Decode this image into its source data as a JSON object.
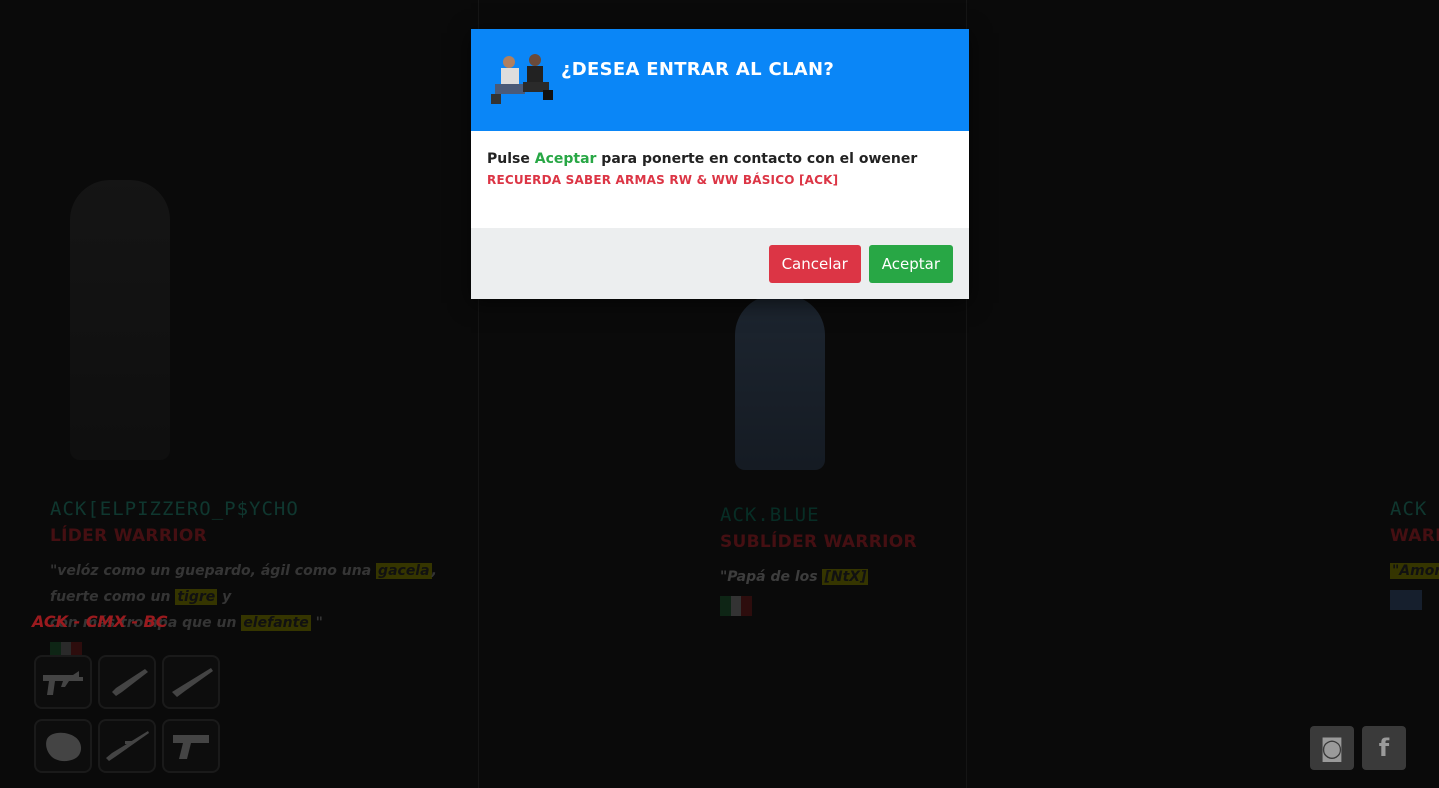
{
  "members": [
    {
      "nick": "ACK[ELPIZZERO_P$YCHO",
      "rank": "LÍDER WARRIOR",
      "quote_parts": [
        "\"velóz como un guepardo, ágil como una ",
        "gacela",
        ",",
        "fuerte como un ",
        "tigre",
        " y",
        "con más trompa que un ",
        "elefante",
        " \""
      ]
    },
    {
      "nick": "ACK.BLUE",
      "rank": "SUBLÍDER WARRIOR",
      "quote_parts": [
        "\"Papá de los ",
        "[NtX]"
      ]
    },
    {
      "nick": "ACK",
      "rank": "WARR",
      "quote_parts": [
        "\"Amor"
      ]
    }
  ],
  "clan_tag": "ACK - CMX - BC",
  "weapons": [
    "smg-icon",
    "shotgun-icon",
    "rifle-icon",
    "fist-icon",
    "sniper-icon",
    "pistol-icon"
  ],
  "social": [
    {
      "name": "discord-icon",
      "glyph": "◙"
    },
    {
      "name": "facebook-icon",
      "glyph": "f"
    }
  ],
  "modal": {
    "title": "¿DESEA ENTRAR AL CLAN?",
    "body_prefix": "Pulse ",
    "body_accent": "Aceptar",
    "body_suffix": " para ponerte en contacto con el owener",
    "warning": "RECUERDA SABER ARMAS RW & WW BÁSICO [ACK]",
    "cancel_label": "Cancelar",
    "accept_label": "Aceptar"
  },
  "colors": {
    "header": "#0a86f7",
    "accept": "#28a745",
    "cancel": "#dc3545",
    "warning": "#dc3545"
  }
}
